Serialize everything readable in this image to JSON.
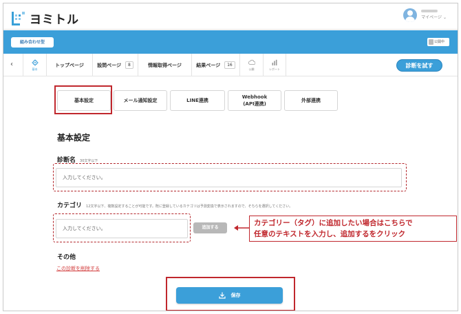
{
  "header": {
    "logo_text": "ヨミトル",
    "user_sub": "マイページ ⌄"
  },
  "bluebar": {
    "left_button": "組み合わせ型",
    "toggle_label": "公開中"
  },
  "nav": {
    "back": "‹",
    "settings_caption": "基本",
    "items": [
      {
        "label": "トップページ",
        "badge": ""
      },
      {
        "label": "設問ページ",
        "badge": "8"
      },
      {
        "label": "情報取得ページ",
        "badge": ""
      },
      {
        "label": "結果ページ",
        "badge": "16"
      }
    ],
    "icon_items": [
      "公開",
      "レポート"
    ],
    "diagnose_button": "診断を試す"
  },
  "tabs": [
    {
      "label": "基本設定"
    },
    {
      "label": "メール通知設定"
    },
    {
      "label": "LINE連携"
    },
    {
      "label": "Webhook\n(API連携)"
    },
    {
      "label": "外部連携"
    }
  ],
  "form": {
    "section_title": "基本設定",
    "name_label": "診断名",
    "name_note": "30文字以下",
    "name_placeholder": "入力してください。",
    "category_label": "カテゴリ",
    "category_note": "12文字以下、複数設定することが可能です。既に登録しているカテゴリは予測変換で表示されますので、そちらを選択してください。",
    "category_placeholder": "入力してください。",
    "add_button": "追加する",
    "other_label": "その他",
    "delete_link": "この診断を削除する",
    "save_button": "保存"
  },
  "annotation": {
    "callout_line1": "カテゴリー（タグ）に追加したい場合はこちらで",
    "callout_line2": "任意のテキストを入力し、追加するをクリック"
  },
  "colors": {
    "brand_blue": "#3b9fd9",
    "annotation_red": "#c0272d",
    "delete_red": "#d23c3c"
  }
}
